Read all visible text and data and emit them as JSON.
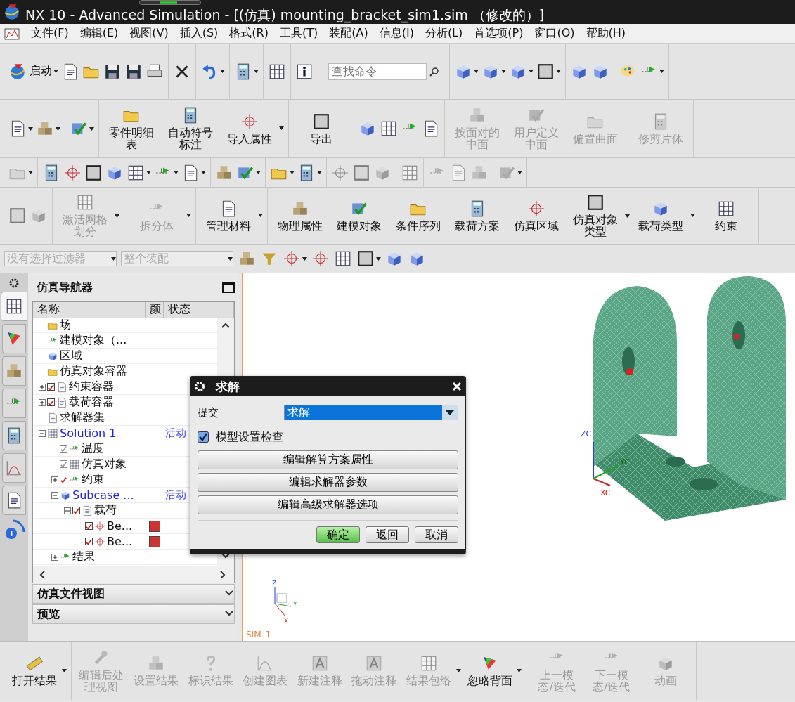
{
  "window": {
    "title": "NX 10 - Advanced Simulation - [(仿真) mounting_bracket_sim1.sim （修改的）]"
  },
  "menu": [
    {
      "label": "文件(F)"
    },
    {
      "label": "编辑(E)"
    },
    {
      "label": "视图(V)"
    },
    {
      "label": "插入(S)"
    },
    {
      "label": "格式(R)"
    },
    {
      "label": "工具(T)"
    },
    {
      "label": "装配(A)"
    },
    {
      "label": "信息(I)"
    },
    {
      "label": "分析(L)"
    },
    {
      "label": "首选项(P)"
    },
    {
      "label": "窗口(O)"
    },
    {
      "label": "帮助(H)"
    }
  ],
  "toolbars": [
    {
      "groups": [
        {
          "items": [
            {
              "kind": "inline",
              "label": "启动",
              "dropdown": true,
              "disabled": false
            },
            {
              "kind": "icon",
              "dropdown": false,
              "disabled": false
            },
            {
              "kind": "icon",
              "dropdown": false,
              "disabled": false
            },
            {
              "kind": "icon",
              "dropdown": false,
              "disabled": false
            },
            {
              "kind": "icon",
              "dropdown": false,
              "disabled": false
            },
            {
              "kind": "icon",
              "dropdown": false,
              "disabled": false
            }
          ]
        },
        {
          "items": [
            {
              "kind": "icon",
              "dropdown": false,
              "disabled": false
            }
          ]
        },
        {
          "items": [
            {
              "kind": "icon",
              "dropdown": true,
              "disabled": false
            }
          ]
        },
        {
          "items": [
            {
              "kind": "icon",
              "dropdown": true,
              "disabled": false
            }
          ]
        },
        {
          "items": [
            {
              "kind": "icon",
              "dropdown": false,
              "disabled": false
            }
          ]
        },
        {
          "items": [
            {
              "kind": "icon",
              "dropdown": false,
              "disabled": false
            }
          ]
        },
        {
          "items": [
            {
              "kind": "search",
              "placeholder": "查找命令"
            }
          ]
        },
        {
          "items": [
            {
              "kind": "icon",
              "dropdown": true,
              "disabled": false
            },
            {
              "kind": "icon",
              "dropdown": true,
              "disabled": false
            },
            {
              "kind": "icon",
              "dropdown": true,
              "disabled": false
            },
            {
              "kind": "icon",
              "dropdown": true,
              "disabled": false
            }
          ]
        },
        {
          "items": [
            {
              "kind": "icon",
              "dropdown": false,
              "disabled": false
            },
            {
              "kind": "icon",
              "dropdown": false,
              "disabled": false
            }
          ]
        },
        {
          "items": [
            {
              "kind": "icon",
              "dropdown": false,
              "disabled": false
            },
            {
              "kind": "icon",
              "dropdown": true,
              "disabled": false
            }
          ]
        }
      ]
    },
    {
      "groups": [
        {
          "items": [
            {
              "kind": "icon",
              "dropdown": true,
              "disabled": false
            },
            {
              "kind": "icon",
              "dropdown": true,
              "disabled": false
            }
          ]
        },
        {
          "items": [
            {
              "kind": "icon",
              "dropdown": true,
              "disabled": false
            }
          ]
        },
        {
          "items": [
            {
              "kind": "big",
              "label": "零件明细表",
              "dropdown": false,
              "disabled": false
            },
            {
              "kind": "big",
              "label": "自动符号标注",
              "dropdown": false,
              "disabled": false
            },
            {
              "kind": "big",
              "label": "导入属性",
              "dropdown": true,
              "disabled": false
            }
          ]
        },
        {
          "items": [
            {
              "kind": "big",
              "label": "导出",
              "dropdown": false,
              "disabled": false
            }
          ]
        },
        {
          "items": [
            {
              "kind": "icon",
              "dropdown": false,
              "disabled": false
            },
            {
              "kind": "icon",
              "dropdown": false,
              "disabled": false
            },
            {
              "kind": "icon",
              "dropdown": false,
              "disabled": false
            },
            {
              "kind": "icon",
              "dropdown": false,
              "disabled": false
            }
          ]
        },
        {
          "items": [
            {
              "kind": "big",
              "label": "按面对的中面",
              "dropdown": false,
              "disabled": true
            },
            {
              "kind": "big",
              "label": "用户定义中面",
              "dropdown": false,
              "disabled": true
            },
            {
              "kind": "big",
              "label": "偏置曲面",
              "dropdown": false,
              "disabled": true
            }
          ]
        },
        {
          "items": [
            {
              "kind": "big",
              "label": "修剪片体",
              "dropdown": false,
              "disabled": true
            }
          ]
        }
      ]
    },
    {
      "groups": [
        {
          "items": [
            {
              "kind": "icon",
              "dropdown": true,
              "disabled": true
            }
          ]
        },
        {
          "items": [
            {
              "kind": "icon",
              "dropdown": false,
              "disabled": false
            },
            {
              "kind": "icon",
              "dropdown": false,
              "disabled": false
            },
            {
              "kind": "icon",
              "dropdown": false,
              "disabled": false
            },
            {
              "kind": "icon",
              "dropdown": false,
              "disabled": false
            },
            {
              "kind": "icon",
              "dropdown": true,
              "disabled": false
            },
            {
              "kind": "icon",
              "dropdown": true,
              "disabled": false
            },
            {
              "kind": "icon",
              "dropdown": true,
              "disabled": false
            }
          ]
        },
        {
          "items": [
            {
              "kind": "icon",
              "dropdown": false,
              "disabled": false
            },
            {
              "kind": "icon",
              "dropdown": true,
              "disabled": false
            }
          ]
        },
        {
          "items": [
            {
              "kind": "icon",
              "dropdown": true,
              "disabled": false
            },
            {
              "kind": "icon",
              "dropdown": true,
              "disabled": false
            }
          ]
        },
        {
          "items": [
            {
              "kind": "icon",
              "dropdown": false,
              "disabled": true
            },
            {
              "kind": "icon",
              "dropdown": false,
              "disabled": true
            },
            {
              "kind": "icon",
              "dropdown": false,
              "disabled": true
            }
          ]
        },
        {
          "items": [
            {
              "kind": "icon",
              "dropdown": false,
              "disabled": true
            }
          ]
        },
        {
          "items": [
            {
              "kind": "icon",
              "dropdown": false,
              "disabled": true
            },
            {
              "kind": "icon",
              "dropdown": false,
              "disabled": true
            },
            {
              "kind": "icon",
              "dropdown": false,
              "disabled": true
            }
          ]
        },
        {
          "items": [
            {
              "kind": "icon",
              "dropdown": true,
              "disabled": true
            }
          ]
        }
      ]
    },
    {
      "groups": [
        {
          "items": [
            {
              "kind": "icon",
              "dropdown": false,
              "disabled": true
            },
            {
              "kind": "icon",
              "dropdown": false,
              "disabled": true
            }
          ]
        },
        {
          "items": [
            {
              "kind": "big",
              "label": "激活网格划分",
              "dropdown": true,
              "disabled": true
            }
          ]
        },
        {
          "items": [
            {
              "kind": "big",
              "label": "拆分体",
              "dropdown": true,
              "disabled": true
            }
          ]
        },
        {
          "items": [
            {
              "kind": "big",
              "label": "管理材料",
              "dropdown": true,
              "disabled": false
            }
          ]
        },
        {
          "items": [
            {
              "kind": "big",
              "label": "物理属性",
              "dropdown": false,
              "disabled": false
            },
            {
              "kind": "big",
              "label": "建模对象",
              "dropdown": false,
              "disabled": false
            },
            {
              "kind": "big",
              "label": "条件序列",
              "dropdown": false,
              "disabled": false
            },
            {
              "kind": "big",
              "label": "载荷方案",
              "dropdown": false,
              "disabled": false
            },
            {
              "kind": "big",
              "label": "仿真区域",
              "dropdown": false,
              "disabled": false
            },
            {
              "kind": "big",
              "label": "仿真对象类型",
              "dropdown": true,
              "disabled": false
            },
            {
              "kind": "big",
              "label": "载荷类型",
              "dropdown": true,
              "disabled": false
            },
            {
              "kind": "big",
              "label": "约束",
              "dropdown": false,
              "disabled": false
            }
          ]
        }
      ]
    }
  ],
  "filter_bar": {
    "filters": [
      {
        "value": "没有选择过滤器",
        "disabled": true
      },
      {
        "value": "整个装配",
        "disabled": true
      }
    ],
    "items": [
      {
        "kind": "icon",
        "dropdown": false,
        "disabled": false
      },
      {
        "kind": "icon",
        "dropdown": false,
        "disabled": false
      },
      {
        "kind": "icon",
        "dropdown": true,
        "disabled": false
      },
      {
        "kind": "icon",
        "dropdown": false,
        "disabled": false
      },
      {
        "kind": "icon",
        "dropdown": false,
        "disabled": false
      },
      {
        "kind": "icon",
        "dropdown": true,
        "disabled": false
      },
      {
        "kind": "icon",
        "dropdown": false,
        "disabled": false
      },
      {
        "kind": "icon",
        "dropdown": false,
        "disabled": false
      }
    ]
  },
  "side_tabs": [
    {
      "selected": true
    },
    {
      "selected": false
    },
    {
      "selected": false
    },
    {
      "selected": false
    },
    {
      "selected": false
    },
    {
      "selected": false
    },
    {
      "selected": false
    }
  ],
  "navigator": {
    "title": "仿真导航器",
    "columns": [
      "名称",
      "颜",
      "状态"
    ],
    "tree": [
      {
        "label": "场",
        "active": false
      },
      {
        "label": "建模对象（...",
        "active": false
      },
      {
        "label": "区域",
        "active": false
      },
      {
        "label": "仿真对象容器",
        "active": false
      },
      {
        "label": "约束容器",
        "active": false,
        "checked": true,
        "expanded": false
      },
      {
        "label": "载荷容器",
        "active": false,
        "checked": true,
        "expanded": false
      },
      {
        "label": "求解器集",
        "active": false
      },
      {
        "label": "Solution 1",
        "active": true,
        "status": "活动",
        "expanded": true,
        "children": [
          {
            "label": "温度",
            "active": false,
            "checked": true,
            "dimmed": true
          },
          {
            "label": "仿真对象",
            "active": false,
            "checked": true,
            "dimmed": true
          },
          {
            "label": "约束",
            "active": false,
            "checked": true,
            "expanded": false
          },
          {
            "label": "Subcase ...",
            "active": true,
            "status": "活动",
            "expanded": true,
            "children": [
              {
                "label": "载荷",
                "active": false,
                "checked": true,
                "expanded": true,
                "children": [
                  {
                    "label": "Be...",
                    "active": false,
                    "checked": true,
                    "color": "#cc3333"
                  },
                  {
                    "label": "Be...",
                    "active": false,
                    "checked": true,
                    "color": "#cc3333"
                  }
                ]
              }
            ]
          },
          {
            "label": "结果",
            "active": false,
            "expanded": false
          }
        ]
      }
    ],
    "sections": [
      {
        "title": "仿真文件视图",
        "expanded": false
      },
      {
        "title": "预览",
        "expanded": false
      }
    ]
  },
  "viewport": {
    "view_name": "SIM_1",
    "triad_labels": [
      "ZC",
      "XC",
      "YC"
    ],
    "mini_triad_labels": [
      "Z",
      "Y",
      "X"
    ]
  },
  "dialog": {
    "title": "求解",
    "submit_label": "提交",
    "submit_value": "求解",
    "check": {
      "label": "模型设置检查",
      "checked": true
    },
    "buttons": [
      {
        "label": "编辑解算方案属性"
      },
      {
        "label": "编辑求解器参数"
      },
      {
        "label": "编辑高级求解器选项"
      }
    ],
    "actions": [
      {
        "label": "确定",
        "default": true
      },
      {
        "label": "返回",
        "default": false
      },
      {
        "label": "取消",
        "default": false
      }
    ]
  },
  "bottom_toolbar": {
    "groups": [
      {
        "items": [
          {
            "kind": "big",
            "label": "打开结果",
            "dropdown": true,
            "disabled": false
          }
        ]
      },
      {
        "items": [
          {
            "kind": "big",
            "label": "编辑后处理视图",
            "dropdown": false,
            "disabled": true
          },
          {
            "kind": "big",
            "label": "设置结果",
            "dropdown": false,
            "disabled": true
          },
          {
            "kind": "big",
            "label": "标识结果",
            "dropdown": false,
            "disabled": true
          },
          {
            "kind": "big",
            "label": "创建图表",
            "dropdown": false,
            "disabled": true
          },
          {
            "kind": "big",
            "label": "新建注释",
            "dropdown": false,
            "disabled": true
          },
          {
            "kind": "big",
            "label": "拖动注释",
            "dropdown": false,
            "disabled": true
          },
          {
            "kind": "big",
            "label": "结果包络",
            "dropdown": true,
            "disabled": true
          },
          {
            "kind": "big",
            "label": "忽略背面",
            "dropdown": true,
            "disabled": false
          }
        ]
      },
      {
        "items": [
          {
            "kind": "big",
            "label": "上一模态/迭代",
            "dropdown": false,
            "disabled": true
          },
          {
            "kind": "big",
            "label": "下一模态/迭代",
            "dropdown": false,
            "disabled": true
          },
          {
            "kind": "big",
            "label": "动画",
            "dropdown": false,
            "disabled": true
          }
        ]
      }
    ]
  }
}
